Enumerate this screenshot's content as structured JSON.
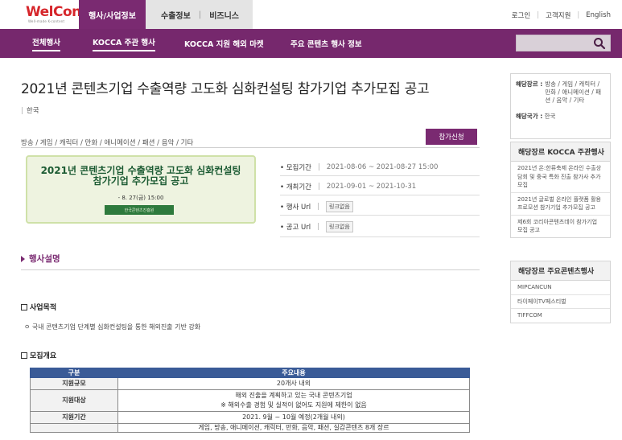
{
  "header": {
    "logo_text": "WelCon",
    "logo_tagline": "Well-made K-content",
    "tabs": [
      {
        "label": "행사/사업정보"
      },
      {
        "label": "수출정보"
      },
      {
        "label": "비즈니스"
      }
    ],
    "util_links": [
      "로그인",
      "고객지원",
      "English"
    ]
  },
  "subnav": {
    "items": [
      {
        "label": "전체행사"
      },
      {
        "label": "KOCCA 주관 행사"
      },
      {
        "label": "KOCCA 지원 해외 마켓"
      },
      {
        "label": "주요 콘텐츠 행사 정보"
      }
    ],
    "search_placeholder": ""
  },
  "event": {
    "title": "2021년 콘텐츠기업 수출역량 고도화 심화컨설팅 참가기업 추가모집 공고",
    "country": "한국",
    "genres": "방송 / 게임 / 캐릭터 / 만화 / 애니메이션 / 패션 / 음악 / 기타",
    "apply_label": "참가신청",
    "banner": {
      "line1": "2021년 콘텐츠기업 수출역량 고도화 심화컨설팅",
      "line2": "참가기업 추가모집 공고",
      "date": "- 8. 27(금) 15:00",
      "org": "한국콘텐츠진흥원"
    },
    "info": [
      {
        "label": "• 모집기간",
        "value": "2021-08-06 ~ 2021-08-27 15:00"
      },
      {
        "label": "• 개최기간",
        "value": "2021-09-01 ~ 2021-10-31"
      },
      {
        "label": "• 행사 Url",
        "value": "링크없음"
      },
      {
        "label": "• 공고 Url",
        "value": "링크없음"
      }
    ]
  },
  "description": {
    "heading": "행사설명",
    "purpose_title": "사업목적",
    "purpose_text": "ㅇ 국내 콘텐츠기업 단계별 심화컨설팅을 통한 해외진출 기반 강화",
    "recruit_title": "모집개요",
    "table": {
      "headers": [
        "구분",
        "주요내용"
      ],
      "rows": [
        {
          "label": "지원규모",
          "lines": [
            "20개사 내외"
          ]
        },
        {
          "label": "지원대상",
          "lines": [
            "해외 진출을 계획하고 있는 국내 콘텐츠기업",
            "※ 해외수출 경험 및 실적이 없어도 지원에 제한이 없음"
          ]
        },
        {
          "label": "지원기간",
          "lines": [
            "2021. 9월 ~ 10월 예정(2개월 내외)"
          ]
        },
        {
          "label": "",
          "lines": [
            "게임, 방송, 애니메이션, 캐릭터, 만화, 음악, 패션, 실감콘텐츠 8개 장르"
          ]
        }
      ]
    }
  },
  "sidebar": {
    "genre_label": "해당장르 :",
    "genre_value": "방송 / 게임 / 캐릭터 / 만화 / 애니메이션 / 패션 / 음악 / 기타",
    "country_label": "해당국가 :",
    "country_value": "한국",
    "kocca_box": {
      "title": "해당장르 KOCCA 주관행사",
      "items": [
        "2021년 온:한류축제 온라인 수출상담회 및 중국 특화 진출 참가사 추가모집",
        "2021년 글로벌 온라인 플랫폼 활용 프로모션 참가기업 추가모집 공고",
        "제6회 코리아콘텐츠데이 참가기업 모집 공고"
      ]
    },
    "major_box": {
      "title": "해당장르 주요콘텐츠행사",
      "items": [
        "MIPCANCUN",
        "타이페이TV페스티벌",
        "TIFFCOM"
      ]
    }
  },
  "colors": {
    "brand_purple": "#76286d",
    "logo_red": "#d6262b",
    "table_header": "#3a5b97"
  }
}
